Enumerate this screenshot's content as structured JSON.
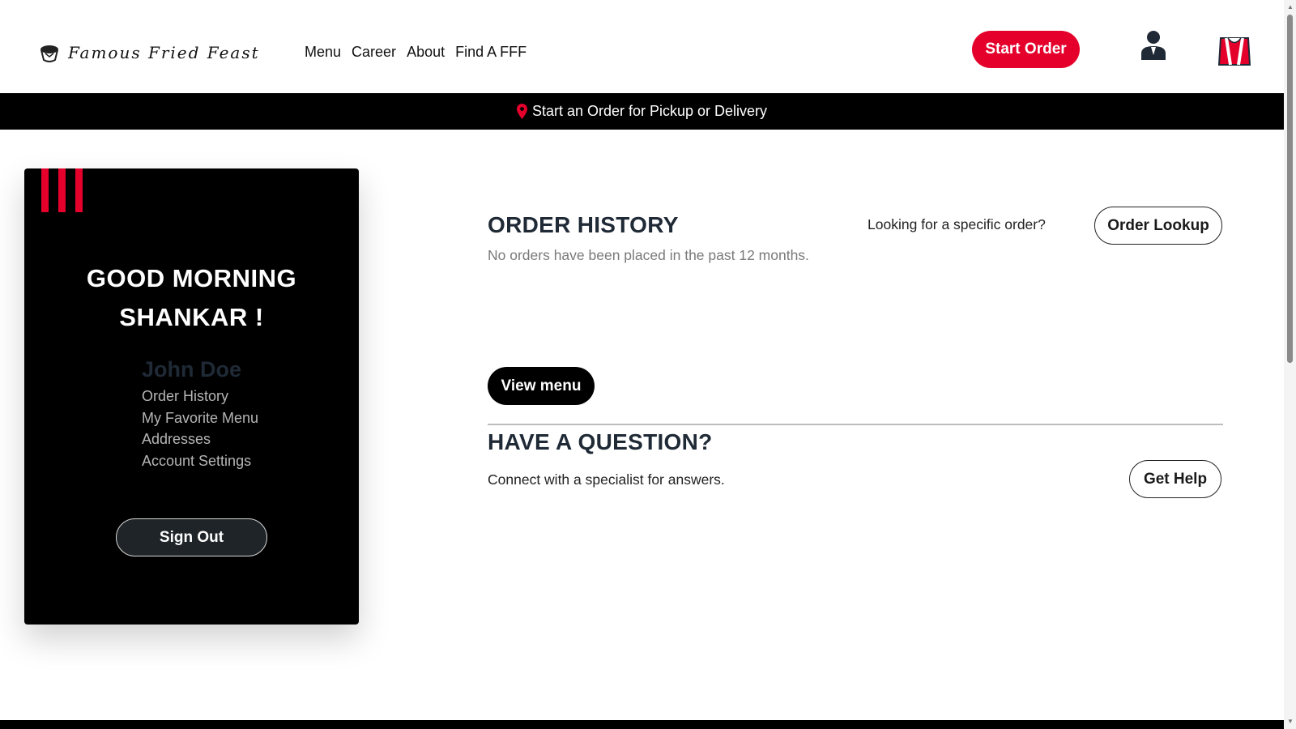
{
  "header": {
    "logo_text": "Famous Fried Feast",
    "nav": [
      "Menu",
      "Career",
      "About",
      "Find A FFF"
    ],
    "start_order": "Start Order",
    "icons": {
      "logo": "bucket-logo-icon",
      "user": "user-icon",
      "bag": "shopping-bag-icon"
    }
  },
  "banner": {
    "text": "Start an Order for Pickup or Delivery",
    "icon": "location-pin-icon"
  },
  "account": {
    "greeting_line1": "GOOD MORNING",
    "greeting_line2": "SHANKAR !",
    "name": "John Doe",
    "links": [
      "Order History",
      "My Favorite Menu",
      "Addresses",
      "Account Settings"
    ],
    "sign_out": "Sign Out"
  },
  "order_history": {
    "title": "ORDER HISTORY",
    "subtitle": "No orders have been placed in the past 12 months.",
    "lookup_question": "Looking for a specific order?",
    "lookup_button": "Order Lookup",
    "view_menu": "View menu"
  },
  "question": {
    "title": "HAVE A QUESTION?",
    "subtitle": "Connect with a specialist for answers.",
    "button": "Get Help"
  },
  "colors": {
    "accent": "#e4002b",
    "dark": "#000000",
    "heading": "#1f2a36"
  }
}
